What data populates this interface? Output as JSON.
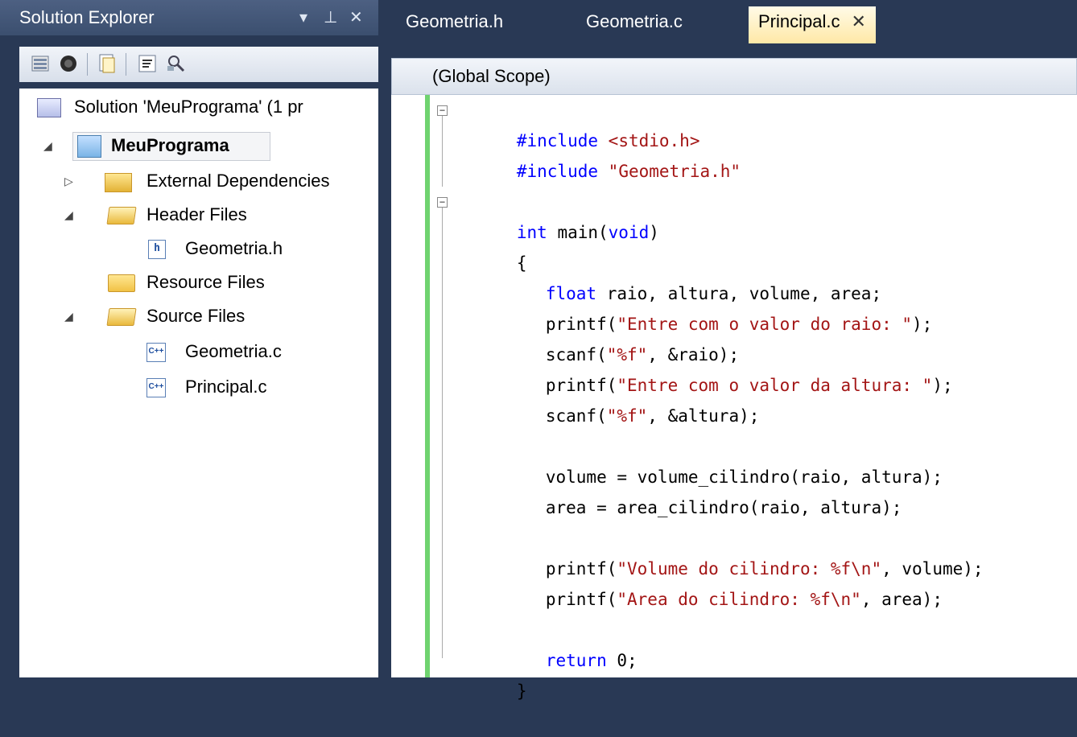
{
  "explorer": {
    "title": "Solution Explorer",
    "controls": [
      "▾",
      "⊥",
      "✕"
    ],
    "toolbar_icons": [
      "properties-icon",
      "show-all-files-icon",
      "refresh-icon",
      "view-code-icon",
      "class-view-icon"
    ],
    "tree": [
      {
        "label": "Solution 'MeuPrograma' (1 pr",
        "icon": "solution-icon",
        "arrow": ""
      },
      {
        "label": "MeuPrograma",
        "icon": "project-icon",
        "arrow": "◢",
        "bold": true
      },
      {
        "label": "External Dependencies",
        "icon": "external-dependencies-icon",
        "arrow": "▷"
      },
      {
        "label": "Header Files",
        "icon": "folder-open-icon",
        "arrow": "◢"
      },
      {
        "label": "Geometria.h",
        "icon": "header-file-icon",
        "arrow": ""
      },
      {
        "label": "Resource Files",
        "icon": "folder-icon",
        "arrow": ""
      },
      {
        "label": "Source Files",
        "icon": "folder-open-icon",
        "arrow": "◢"
      },
      {
        "label": "Geometria.c",
        "icon": "cpp-file-icon",
        "arrow": ""
      },
      {
        "label": "Principal.c",
        "icon": "cpp-file-icon",
        "arrow": ""
      }
    ],
    "file_icon_h": "h",
    "file_icon_c": "C++"
  },
  "editor": {
    "tabs": [
      {
        "label": "Geometria.h"
      },
      {
        "label": "Geometria.c"
      },
      {
        "label": "Principal.c",
        "active": true,
        "close": "✕"
      }
    ],
    "scope": "(Global Scope)",
    "fold_minus": "−",
    "code": {
      "l1_pp": "#include",
      "l1_inc": "<stdio.h>",
      "l2_pp": "#include",
      "l2_inc": "\"Geometria.h\"",
      "l4_kw": "int",
      "l4_a": " main(",
      "l4_kw2": "void",
      "l4_b": ")",
      "l5": "{",
      "l6_kw": "float",
      "l6_rest": " raio, altura, volume, area;",
      "l7_a": "printf(",
      "l7_str": "\"Entre com o valor do raio: \"",
      "l7_b": ");",
      "l8_a": "scanf(",
      "l8_str": "\"%f\"",
      "l8_b": ", &raio);",
      "l9_a": "printf(",
      "l9_str": "\"Entre com o valor da altura: \"",
      "l9_b": ");",
      "l10_a": "scanf(",
      "l10_str": "\"%f\"",
      "l10_b": ", &altura);",
      "l12": "volume = volume_cilindro(raio, altura);",
      "l13": "area = area_cilindro(raio, altura);",
      "l15_a": "printf(",
      "l15_str": "\"Volume do cilindro: %f\\n\"",
      "l15_b": ", volume);",
      "l16_a": "printf(",
      "l16_str": "\"Area do cilindro: %f\\n\"",
      "l16_b": ", area);",
      "l18_kw": "return",
      "l18_rest": " 0;",
      "l19": "}"
    }
  }
}
